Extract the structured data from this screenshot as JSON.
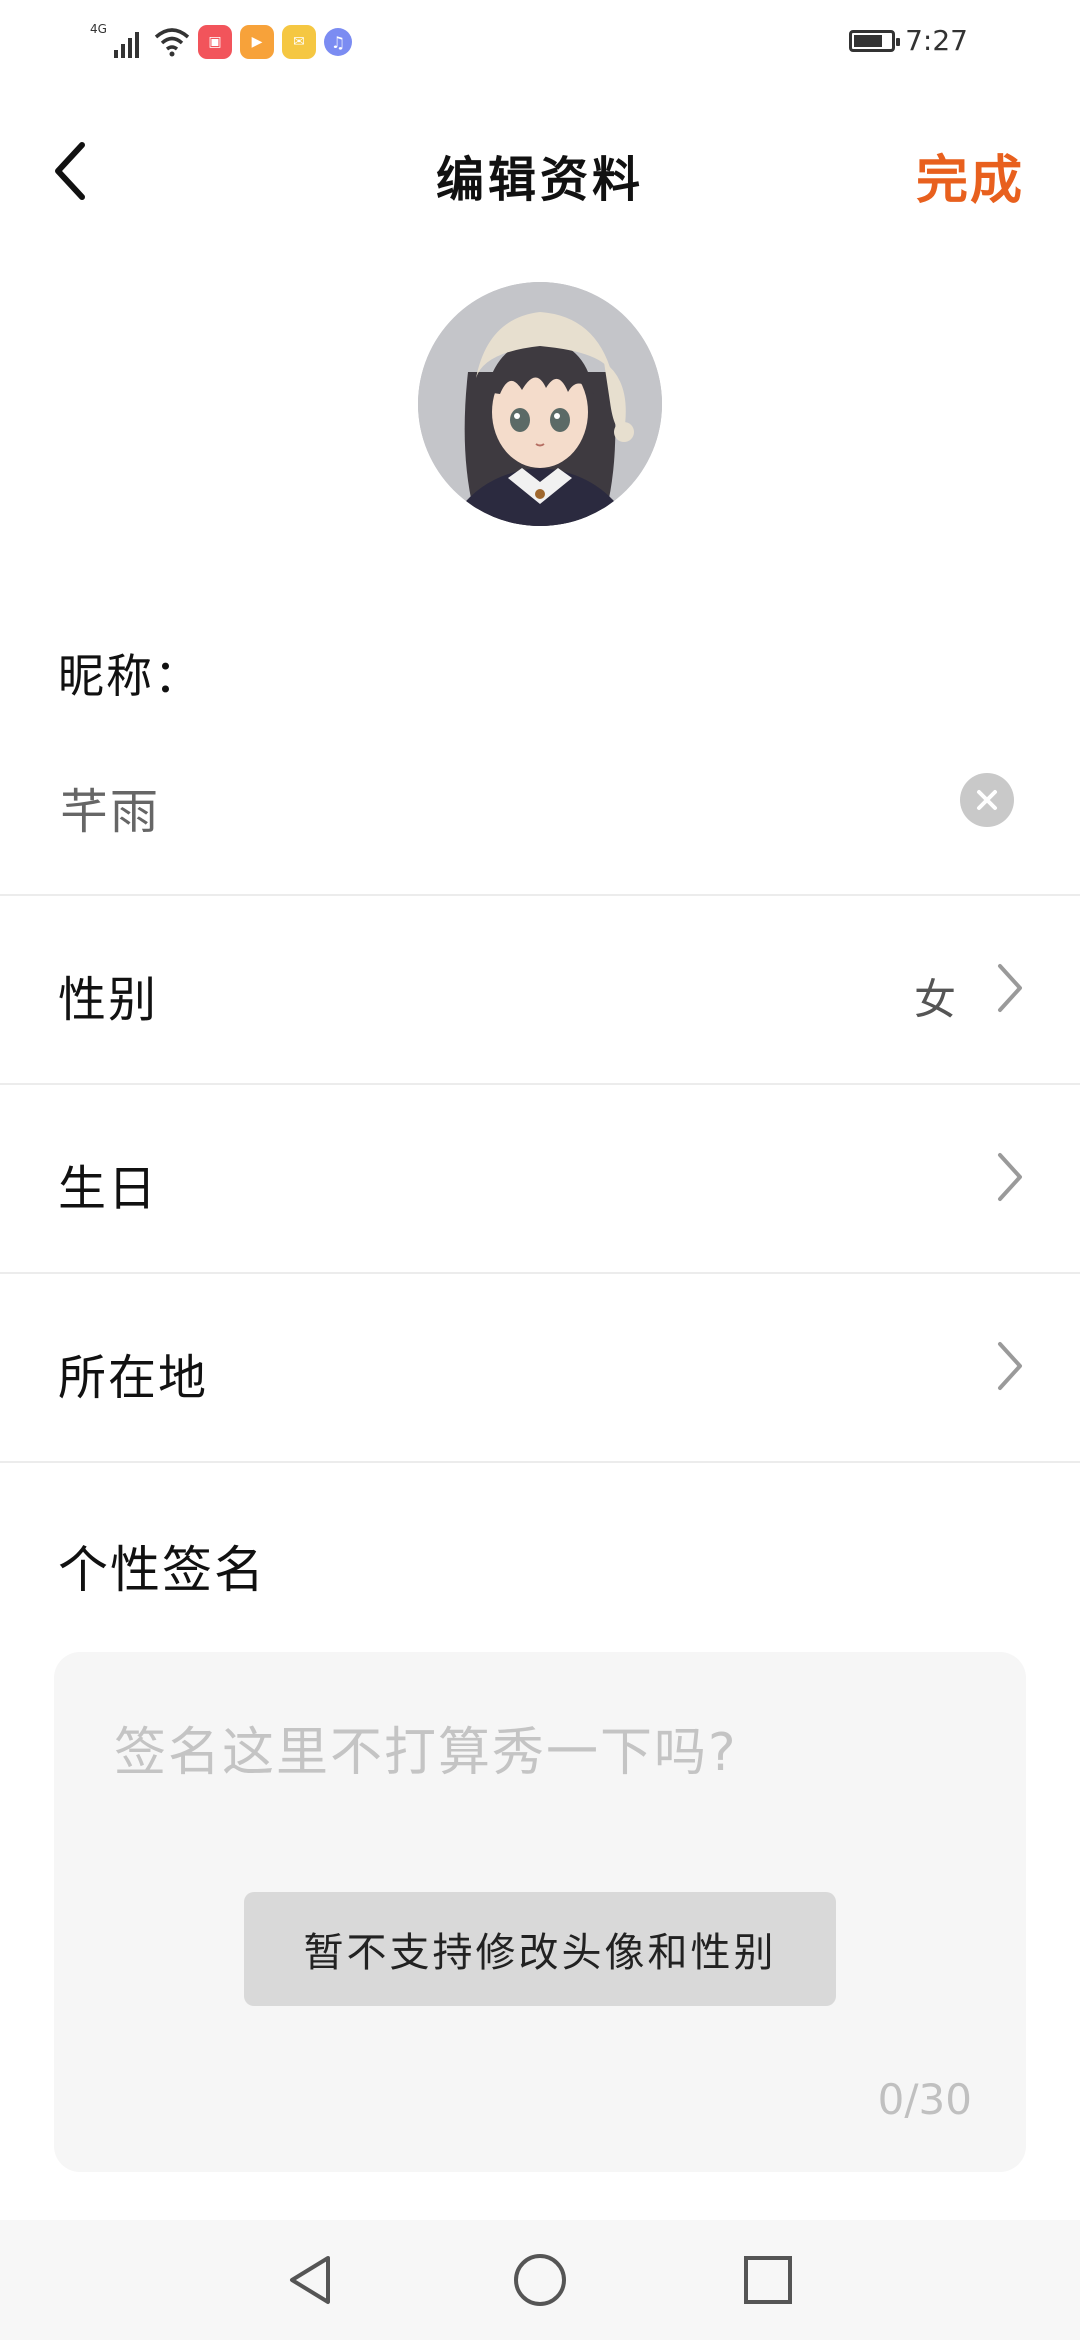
{
  "status_bar": {
    "network": "4G",
    "time": "7:27",
    "apps": [
      {
        "name": "huawei-store-icon",
        "color": "#f2545b",
        "glyph": "▣"
      },
      {
        "name": "video-app-icon",
        "color": "#f7a23a",
        "glyph": "▶"
      },
      {
        "name": "mail-app-icon",
        "color": "#f5c742",
        "glyph": "✉"
      },
      {
        "name": "music-app-icon",
        "color": "#7b8cf2",
        "glyph": "♫"
      }
    ]
  },
  "header": {
    "title": "编辑资料",
    "done_label": "完成"
  },
  "form": {
    "nickname_label": "昵称：",
    "nickname_value": "芊雨",
    "gender_label": "性别",
    "gender_value": "女",
    "birthday_label": "生日",
    "location_label": "所在地",
    "signature_label": "个性签名",
    "signature_placeholder": "签名这里不打算秀一下吗?",
    "signature_counter": "0/30"
  },
  "toast": {
    "message": "暂不支持修改头像和性别"
  },
  "colors": {
    "accent": "#e8601e",
    "divider": "#ececec",
    "input_bg": "#f6f6f6"
  }
}
